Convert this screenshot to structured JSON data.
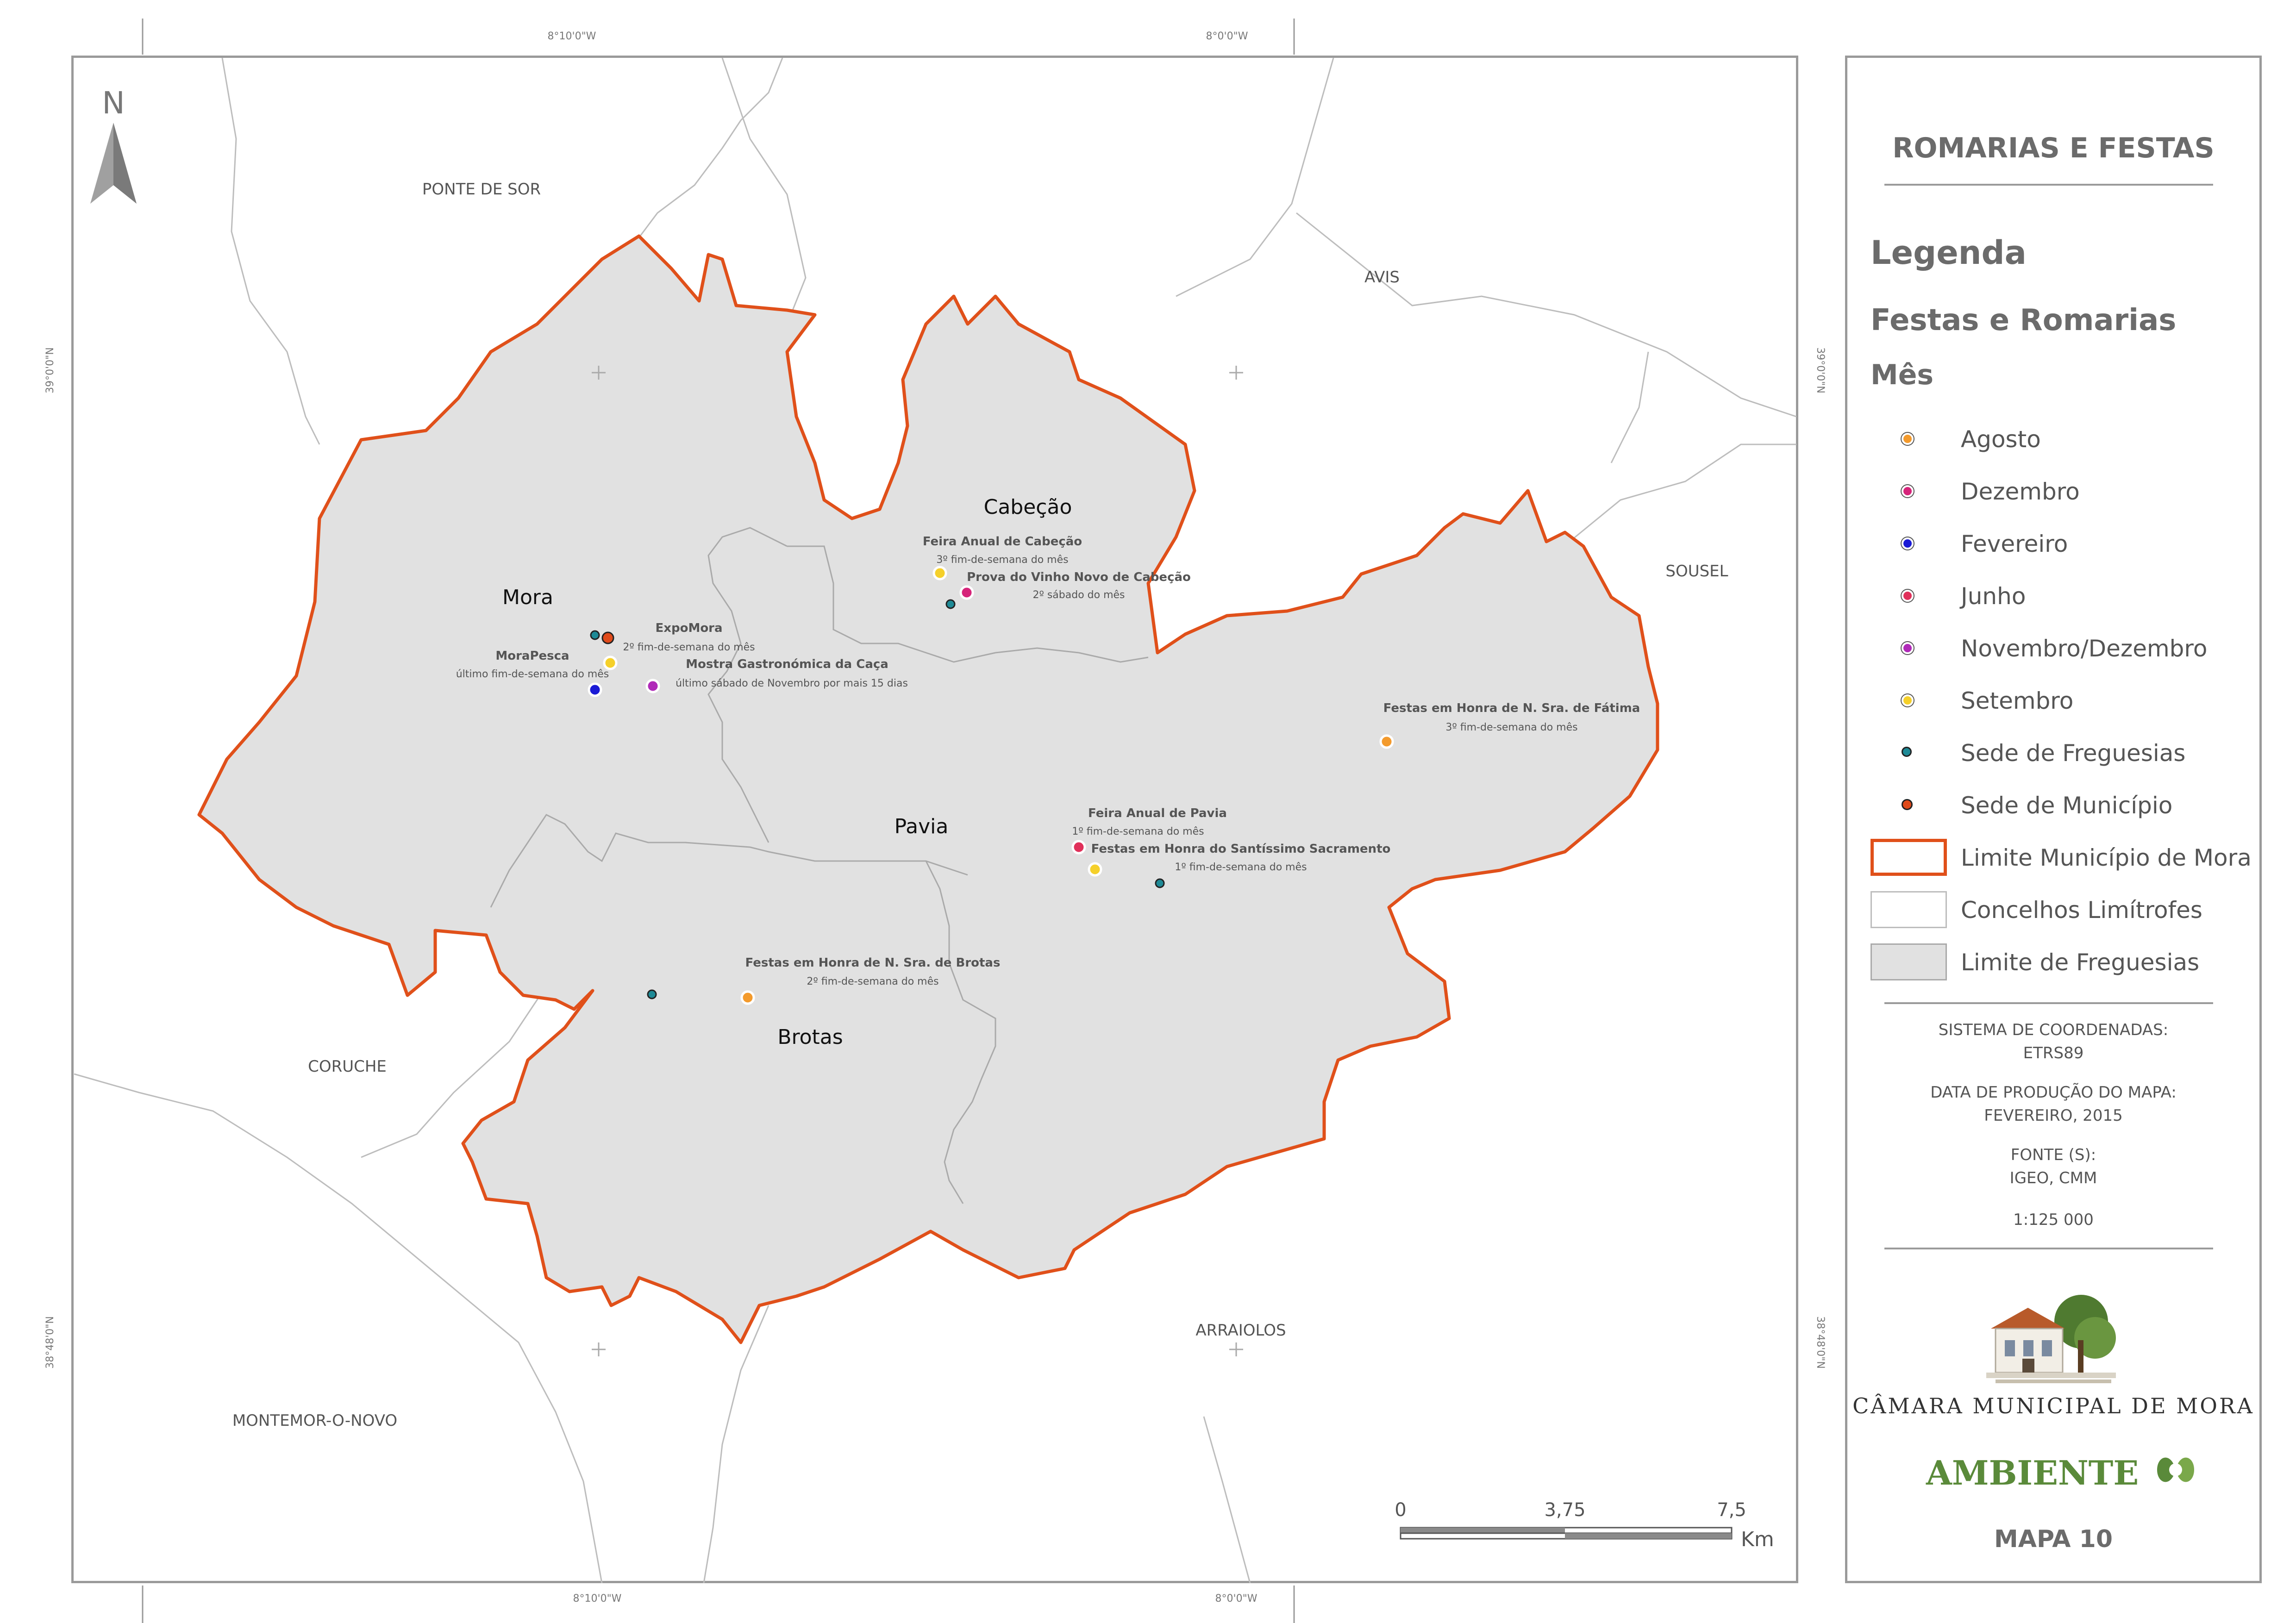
{
  "map": {
    "grid": {
      "lon_left": "8°10'0\"W",
      "lon_right": "8°0'0\"W",
      "lat_top": "39°0'0\"N",
      "lat_bottom": "38°48'0\"N"
    },
    "neighbours": [
      "PONTE DE SOR",
      "AVIS",
      "SOUSEL",
      "CORUCHE",
      "ARRAIOLOS",
      "MONTEMOR-O-NOVO"
    ],
    "parishes": [
      "Mora",
      "Cabeção",
      "Pavia",
      "Brotas"
    ],
    "events": [
      {
        "name": "Feira Anual de Cabeção",
        "when": "3º fim-de-semana do mês",
        "month": "Setembro"
      },
      {
        "name": "Prova do Vinho Novo de Cabeção",
        "when": "2º sábado do mês",
        "month": "Dezembro"
      },
      {
        "name": "ExpoMora",
        "when": "2º fim-de-semana do mês",
        "month": "Setembro"
      },
      {
        "name": "MoraPesca",
        "when": "último fim-de-semana do mês",
        "month": "Fevereiro"
      },
      {
        "name": "Mostra Gastronómica da Caça",
        "when": "último sábado de Novembro por mais 15 dias",
        "month": "Novembro/Dezembro"
      },
      {
        "name": "Festas em Honra de N. Sra. de Fátima",
        "when": "3º fim-de-semana do mês",
        "month": "Agosto"
      },
      {
        "name": "Feira Anual de Pavia",
        "when": "1º fim-de-semana do mês",
        "month": "Junho"
      },
      {
        "name": "Festas em Honra do Santíssimo Sacramento",
        "when": "1º fim-de-semana do mês",
        "month": "Setembro"
      },
      {
        "name": "Festas em Honra de N. Sra. de Brotas",
        "when": "2º fim-de-semana do mês",
        "month": "Agosto"
      }
    ],
    "scale_bar": {
      "zero": "0",
      "mid": "3,75",
      "max": "7,5",
      "unit": "Km"
    },
    "north": "N"
  },
  "legend": {
    "title": "ROMARIAS E FESTAS",
    "heading": "Legenda",
    "subheading": "Festas e Romarias",
    "group": "Mês",
    "items": [
      {
        "label": "Agosto",
        "color": "#f39a2c"
      },
      {
        "label": "Dezembro",
        "color": "#d6247a"
      },
      {
        "label": "Fevereiro",
        "color": "#1a1ad6"
      },
      {
        "label": "Junho",
        "color": "#e0305a"
      },
      {
        "label": "Novembro/Dezembro",
        "color": "#b02ab8"
      },
      {
        "label": "Setembro",
        "color": "#f5d02a"
      },
      {
        "label": "Sede de Freguesias",
        "color": "#1e8a96"
      },
      {
        "label": "Sede de Município",
        "color": "#e04a1a"
      },
      {
        "label": "Limite Município de Mora",
        "color": "#e0501a"
      },
      {
        "label": "Concelhos Limítrofes",
        "color": "#ffffff"
      },
      {
        "label": "Limite de Freguesias",
        "color": "#e1e1e1"
      }
    ],
    "coord_label": "SISTEMA DE COORDENADAS:",
    "coord_value": "ETRS89",
    "date_label": "DATA DE PRODUÇÃO DO MAPA:",
    "date_value": "FEVEREIRO, 2015",
    "source_label": "FONTE (S):",
    "source_value": "IGEO, CMM",
    "scale": "1:125 000",
    "org_name": "CÂMARA MUNICIPAL DE MORA",
    "ambiente": "AMBIENTE",
    "map_number": "MAPA 10"
  }
}
